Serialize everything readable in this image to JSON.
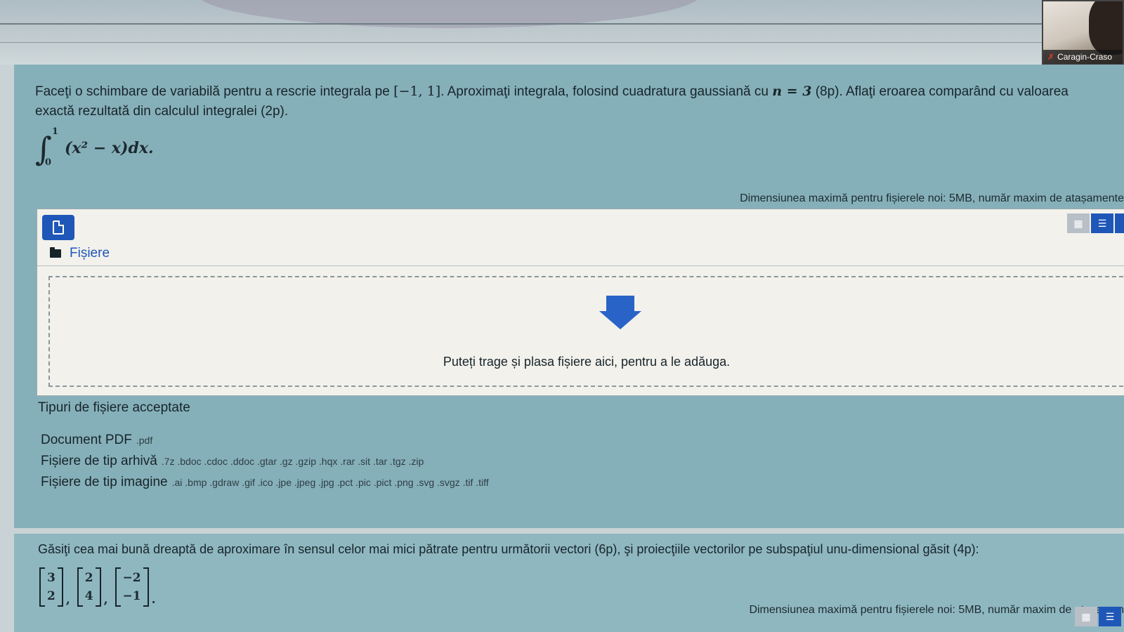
{
  "webcam": {
    "name_label": "Caragin-Craso"
  },
  "q1": {
    "text_a": "Faceţi o schimbare de variabilă pentru a rescrie integrala pe ",
    "interval": "[−1, 1]",
    "text_b": ". Aproximaţi integrala, folosind cuadratura gaussiană cu ",
    "n_eq": "n = 3",
    "text_c": " (8p). Aflaţi eroarea comparând cu valoarea exactă rezultată din calculul integralei (2p).",
    "integral": {
      "sign": "∫",
      "upper": "1",
      "lower": "0",
      "integrand": "(x² − x)dx."
    },
    "max_size_note": "Dimensiunea maximă pentru fișierele noi: 5MB, număr maxim de atașamente",
    "filepicker": {
      "folder_label": "Fișiere",
      "drop_text": "Puteți trage și plasa fișiere aici, pentru a le adăuga."
    },
    "accepted": {
      "title": "Tipuri de fișiere acceptate",
      "types": [
        {
          "label": "Document PDF",
          "exts": ".pdf"
        },
        {
          "label": "Fișiere de tip arhivă",
          "exts": ".7z .bdoc .cdoc .ddoc .gtar .gz .gzip .hqx .rar .sit .tar .tgz .zip"
        },
        {
          "label": "Fișiere de tip imagine",
          "exts": ".ai .bmp .gdraw .gif .ico .jpe .jpeg .jpg .pct .pic .pict .png .svg .svgz .tif .tiff"
        }
      ]
    }
  },
  "q2": {
    "text": "Găsiţi cea mai bună dreaptă de aproximare în sensul celor mai mici pătrate pentru următorii vectori (6p), şi proiecţiile vectorilor pe subspaţiul unu-dimensional găsit (4p):",
    "vectors": [
      [
        "3",
        "2"
      ],
      [
        "2",
        "4"
      ],
      [
        "−2",
        "−1"
      ]
    ],
    "max_size_note": "Dimensiunea maximă pentru fișierele noi: 5MB, număr maxim de atașamen"
  },
  "icons": {
    "add_file": "file-icon",
    "folder": "folder-icon",
    "drop": "down-arrow-icon",
    "view_grid": "grid-icon",
    "view_list": "list-icon",
    "mic": "mic-muted-icon"
  },
  "colors": {
    "accent": "#1f57b8",
    "question_bg": "#86b0b9",
    "picker_bg": "#f2f1ec"
  }
}
